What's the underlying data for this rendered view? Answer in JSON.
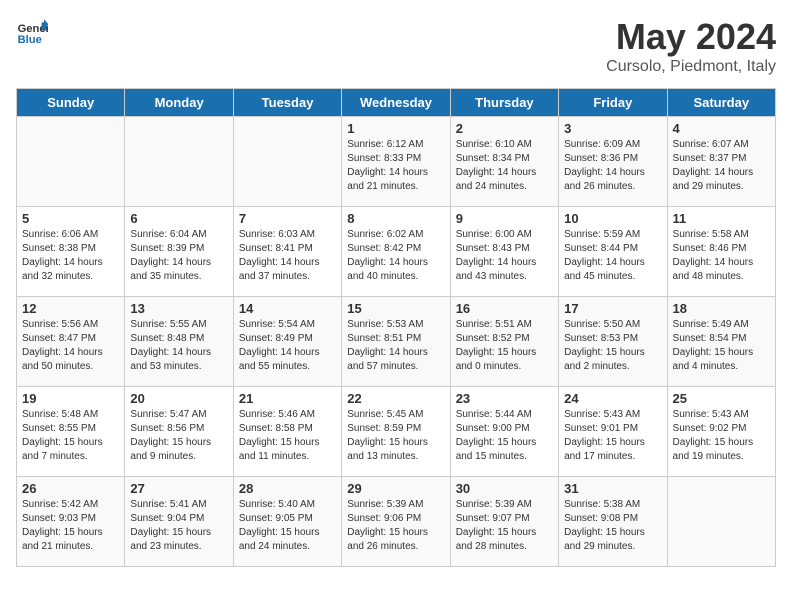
{
  "header": {
    "logo_general": "General",
    "logo_blue": "Blue",
    "title": "May 2024",
    "subtitle": "Cursolo, Piedmont, Italy"
  },
  "weekdays": [
    "Sunday",
    "Monday",
    "Tuesday",
    "Wednesday",
    "Thursday",
    "Friday",
    "Saturday"
  ],
  "weeks": [
    [
      {
        "day": "",
        "content": ""
      },
      {
        "day": "",
        "content": ""
      },
      {
        "day": "",
        "content": ""
      },
      {
        "day": "1",
        "content": "Sunrise: 6:12 AM\nSunset: 8:33 PM\nDaylight: 14 hours and 21 minutes."
      },
      {
        "day": "2",
        "content": "Sunrise: 6:10 AM\nSunset: 8:34 PM\nDaylight: 14 hours and 24 minutes."
      },
      {
        "day": "3",
        "content": "Sunrise: 6:09 AM\nSunset: 8:36 PM\nDaylight: 14 hours and 26 minutes."
      },
      {
        "day": "4",
        "content": "Sunrise: 6:07 AM\nSunset: 8:37 PM\nDaylight: 14 hours and 29 minutes."
      }
    ],
    [
      {
        "day": "5",
        "content": "Sunrise: 6:06 AM\nSunset: 8:38 PM\nDaylight: 14 hours and 32 minutes."
      },
      {
        "day": "6",
        "content": "Sunrise: 6:04 AM\nSunset: 8:39 PM\nDaylight: 14 hours and 35 minutes."
      },
      {
        "day": "7",
        "content": "Sunrise: 6:03 AM\nSunset: 8:41 PM\nDaylight: 14 hours and 37 minutes."
      },
      {
        "day": "8",
        "content": "Sunrise: 6:02 AM\nSunset: 8:42 PM\nDaylight: 14 hours and 40 minutes."
      },
      {
        "day": "9",
        "content": "Sunrise: 6:00 AM\nSunset: 8:43 PM\nDaylight: 14 hours and 43 minutes."
      },
      {
        "day": "10",
        "content": "Sunrise: 5:59 AM\nSunset: 8:44 PM\nDaylight: 14 hours and 45 minutes."
      },
      {
        "day": "11",
        "content": "Sunrise: 5:58 AM\nSunset: 8:46 PM\nDaylight: 14 hours and 48 minutes."
      }
    ],
    [
      {
        "day": "12",
        "content": "Sunrise: 5:56 AM\nSunset: 8:47 PM\nDaylight: 14 hours and 50 minutes."
      },
      {
        "day": "13",
        "content": "Sunrise: 5:55 AM\nSunset: 8:48 PM\nDaylight: 14 hours and 53 minutes."
      },
      {
        "day": "14",
        "content": "Sunrise: 5:54 AM\nSunset: 8:49 PM\nDaylight: 14 hours and 55 minutes."
      },
      {
        "day": "15",
        "content": "Sunrise: 5:53 AM\nSunset: 8:51 PM\nDaylight: 14 hours and 57 minutes."
      },
      {
        "day": "16",
        "content": "Sunrise: 5:51 AM\nSunset: 8:52 PM\nDaylight: 15 hours and 0 minutes."
      },
      {
        "day": "17",
        "content": "Sunrise: 5:50 AM\nSunset: 8:53 PM\nDaylight: 15 hours and 2 minutes."
      },
      {
        "day": "18",
        "content": "Sunrise: 5:49 AM\nSunset: 8:54 PM\nDaylight: 15 hours and 4 minutes."
      }
    ],
    [
      {
        "day": "19",
        "content": "Sunrise: 5:48 AM\nSunset: 8:55 PM\nDaylight: 15 hours and 7 minutes."
      },
      {
        "day": "20",
        "content": "Sunrise: 5:47 AM\nSunset: 8:56 PM\nDaylight: 15 hours and 9 minutes."
      },
      {
        "day": "21",
        "content": "Sunrise: 5:46 AM\nSunset: 8:58 PM\nDaylight: 15 hours and 11 minutes."
      },
      {
        "day": "22",
        "content": "Sunrise: 5:45 AM\nSunset: 8:59 PM\nDaylight: 15 hours and 13 minutes."
      },
      {
        "day": "23",
        "content": "Sunrise: 5:44 AM\nSunset: 9:00 PM\nDaylight: 15 hours and 15 minutes."
      },
      {
        "day": "24",
        "content": "Sunrise: 5:43 AM\nSunset: 9:01 PM\nDaylight: 15 hours and 17 minutes."
      },
      {
        "day": "25",
        "content": "Sunrise: 5:43 AM\nSunset: 9:02 PM\nDaylight: 15 hours and 19 minutes."
      }
    ],
    [
      {
        "day": "26",
        "content": "Sunrise: 5:42 AM\nSunset: 9:03 PM\nDaylight: 15 hours and 21 minutes."
      },
      {
        "day": "27",
        "content": "Sunrise: 5:41 AM\nSunset: 9:04 PM\nDaylight: 15 hours and 23 minutes."
      },
      {
        "day": "28",
        "content": "Sunrise: 5:40 AM\nSunset: 9:05 PM\nDaylight: 15 hours and 24 minutes."
      },
      {
        "day": "29",
        "content": "Sunrise: 5:39 AM\nSunset: 9:06 PM\nDaylight: 15 hours and 26 minutes."
      },
      {
        "day": "30",
        "content": "Sunrise: 5:39 AM\nSunset: 9:07 PM\nDaylight: 15 hours and 28 minutes."
      },
      {
        "day": "31",
        "content": "Sunrise: 5:38 AM\nSunset: 9:08 PM\nDaylight: 15 hours and 29 minutes."
      },
      {
        "day": "",
        "content": ""
      }
    ]
  ]
}
